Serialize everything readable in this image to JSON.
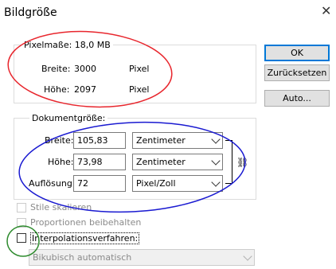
{
  "window": {
    "title": "Bildgröße"
  },
  "pixel_dimensions": {
    "legend": "Pixelmaße: 18,0 MB",
    "width": {
      "label": "Breite:",
      "value": "3000",
      "unit": "Pixel"
    },
    "height": {
      "label": "Höhe:",
      "value": "2097",
      "unit": "Pixel"
    }
  },
  "document_size": {
    "legend": "Dokumentgröße:",
    "width": {
      "label": "Breite:",
      "value": "105,83",
      "unit": "Zentimeter"
    },
    "height": {
      "label": "Höhe:",
      "value": "73,98",
      "unit": "Zentimeter"
    },
    "resolution": {
      "label": "Auflösung:",
      "value": "72",
      "unit": "Pixel/Zoll"
    }
  },
  "options": {
    "scale_styles": {
      "label": "Stile skalieren",
      "checked": false,
      "enabled": false
    },
    "constrain_proportions": {
      "label": "Proportionen beibehalten",
      "checked": false,
      "enabled": false
    },
    "resample": {
      "label": "Interpolationsverfahren:",
      "checked": false,
      "enabled": true
    },
    "resample_method": {
      "value": "Bikubisch automatisch",
      "enabled": false
    }
  },
  "buttons": {
    "ok": "OK",
    "reset": "Zurücksetzen",
    "auto": "Auto..."
  },
  "annotations": {
    "red": "#e8262d",
    "blue": "#1a1ad1",
    "green": "#2e8b2e"
  }
}
